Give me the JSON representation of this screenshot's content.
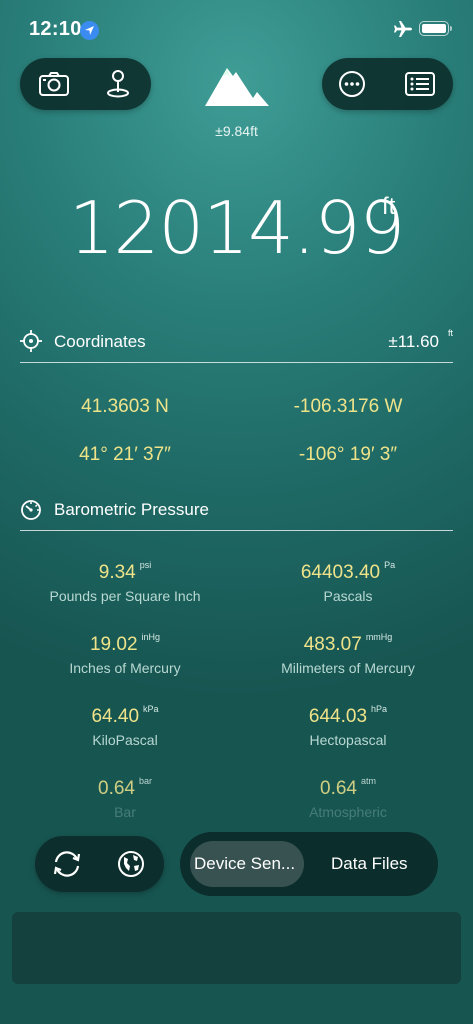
{
  "status": {
    "time": "12:10"
  },
  "header": {
    "accuracy": "±9.84ft"
  },
  "altitude": {
    "value": "12014.99",
    "unit": "ft"
  },
  "coordinates": {
    "title": "Coordinates",
    "accuracy": "±11.60",
    "accuracy_unit": "ft",
    "lat_dec": "41.3603 N",
    "lon_dec": "-106.3176 W",
    "lat_dms": "41° 21′ 37″",
    "lon_dms": "-106° 19′ 3″"
  },
  "pressure": {
    "title": "Barometric Pressure",
    "rows": [
      {
        "value": "9.34",
        "unit": "psi",
        "label": "Pounds per Square Inch"
      },
      {
        "value": "64403.40",
        "unit": "Pa",
        "label": "Pascals"
      },
      {
        "value": "19.02",
        "unit": "inHg",
        "label": "Inches of Mercury"
      },
      {
        "value": "483.07",
        "unit": "mmHg",
        "label": "Milimeters of Mercury"
      },
      {
        "value": "64.40",
        "unit": "kPa",
        "label": "KiloPascal"
      },
      {
        "value": "644.03",
        "unit": "hPa",
        "label": "Hectopascal"
      },
      {
        "value": "0.64",
        "unit": "bar",
        "label": "Bar"
      },
      {
        "value": "0.64",
        "unit": "atm",
        "label": "Atmospheric"
      }
    ]
  },
  "segmented": {
    "option1": "Device Sen...",
    "option2": "Data Files"
  },
  "colors": {
    "value_yellow": "#efe38a",
    "bg_teal": "#2a7f7a"
  }
}
